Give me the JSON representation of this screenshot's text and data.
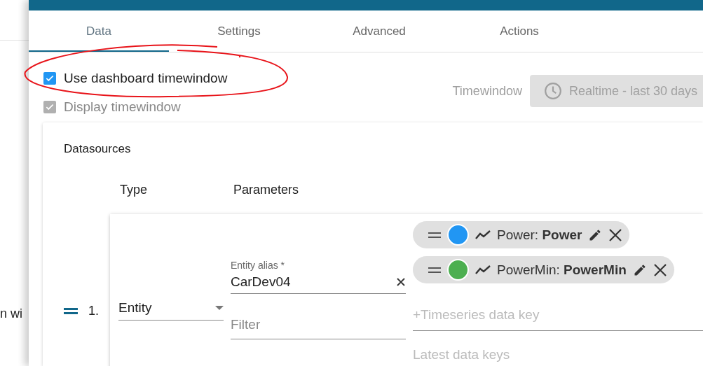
{
  "background_page": {
    "fragment": "n wi"
  },
  "tabs": [
    {
      "label": "Data",
      "selected": true
    },
    {
      "label": "Settings",
      "selected": false
    },
    {
      "label": "Advanced",
      "selected": false
    },
    {
      "label": "Actions",
      "selected": false
    }
  ],
  "options": [
    {
      "label": "Use dashboard timewindow",
      "checked": true,
      "disabled": false
    },
    {
      "label": "Display timewindow",
      "checked": true,
      "disabled": true
    }
  ],
  "timewindow": {
    "label": "Timewindow",
    "button": "Realtime - last 30 days",
    "disabled": true
  },
  "datasources": {
    "title": "Datasources",
    "columns": [
      "Type",
      "Parameters"
    ],
    "rows": [
      {
        "number": "1.",
        "type": "Entity",
        "alias_label": "Entity alias *",
        "alias": "CarDev04",
        "filter_placeholder": "Filter",
        "keys": [
          {
            "label": "Power: **Power**",
            "color": "#2196f3"
          },
          {
            "label": "PowerMin: **PowerMin**",
            "color": "#4caf50"
          }
        ],
        "key_placeholder": "+Timeseries data key",
        "latest_placeholder": "Latest data keys"
      }
    ]
  }
}
